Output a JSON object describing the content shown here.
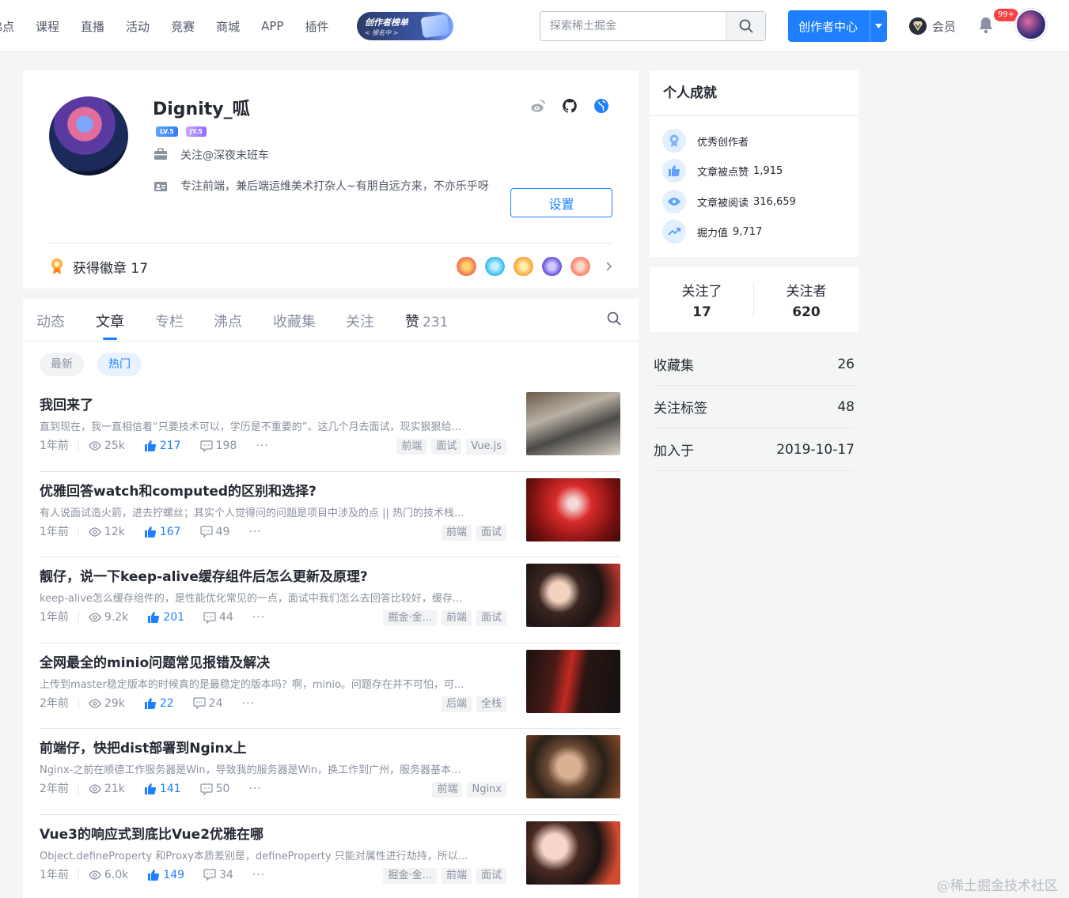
{
  "header": {
    "nav": [
      "沸点",
      "课程",
      "直播",
      "活动",
      "竞赛",
      "商城",
      "APP",
      "插件"
    ],
    "banner": {
      "title": "创作者榜单",
      "subtitle": "< 报名中 >"
    },
    "search_placeholder": "探索稀土掘金",
    "creator_center": "创作者中心",
    "vip_label": "会员",
    "notification_badge": "99+"
  },
  "profile": {
    "username": "Dignity_呱",
    "level": "LV.5",
    "jy_level": "JY.5",
    "position": "关注@深夜末班车",
    "bio": "专注前端，兼后端运维美术打杂人~有朋自远方来，不亦乐乎呀",
    "settings_label": "设置",
    "badges_label": "获得徽章 17",
    "socials": [
      "weibo-icon",
      "github-icon",
      "website-icon"
    ]
  },
  "tabs": {
    "items": [
      "动态",
      "文章",
      "专栏",
      "沸点",
      "收藏集",
      "关注",
      "赞"
    ],
    "likes_count": "231",
    "active": "文章"
  },
  "filters": [
    "最新",
    "热门"
  ],
  "articles": [
    {
      "title": "我回来了",
      "brief": "直到现在，我一直相信着“只要技术可以，学历是不重要的”。这几个月去面试，现实狠狠给...",
      "time": "1年前",
      "views": "25k",
      "likes": "217",
      "comments": "198",
      "tags": [
        "前端",
        "面试",
        "Vue.js"
      ]
    },
    {
      "title": "优雅回答watch和computed的区别和选择?",
      "brief": "有人说面试造火箭，进去拧螺丝；其实个人觉得问的问题是项目中涉及的点 || 热门的技术栈...",
      "time": "1年前",
      "views": "12k",
      "likes": "167",
      "comments": "49",
      "tags": [
        "前端",
        "面试"
      ]
    },
    {
      "title": "靓仔，说一下keep-alive缓存组件后怎么更新及原理?",
      "brief": "keep-alive怎么缓存组件的，是性能优化常见的一点，面试中我们怎么去回答比较好，缓存...",
      "time": "1年前",
      "views": "9.2k",
      "likes": "201",
      "comments": "44",
      "tags": [
        "掘金·金...",
        "前端",
        "面试"
      ]
    },
    {
      "title": "全网最全的minio问题常见报错及解决",
      "brief": "上传到master稳定版本的时候真的是最稳定的版本吗？啊，minio。问题存在并不可怕，可...",
      "time": "2年前",
      "views": "29k",
      "likes": "22",
      "comments": "24",
      "tags": [
        "后端",
        "全栈"
      ]
    },
    {
      "title": "前端仔，快把dist部署到Nginx上",
      "brief": "Nginx-之前在顺德工作服务器是Win，导致我的服务器是Win，换工作到广州，服务器基本...",
      "time": "2年前",
      "views": "21k",
      "likes": "141",
      "comments": "50",
      "tags": [
        "前端",
        "Nginx"
      ]
    },
    {
      "title": "Vue3的响应式到底比Vue2优雅在哪",
      "brief": "Object.defineProperty 和Proxy本质差别是，defineProperty 只能对属性进行劫持，所以...",
      "time": "1年前",
      "views": "6.0k",
      "likes": "149",
      "comments": "34",
      "tags": [
        "掘金·金...",
        "前端",
        "面试"
      ]
    }
  ],
  "achievements": {
    "title": "个人成就",
    "items": [
      {
        "label": "优秀创作者",
        "value": ""
      },
      {
        "label": "文章被点赞",
        "value": "1,915"
      },
      {
        "label": "文章被阅读",
        "value": "316,659"
      },
      {
        "label": "掘力值",
        "value": "9,717"
      }
    ]
  },
  "follow": {
    "following_label": "关注了",
    "following": "17",
    "followers_label": "关注者",
    "followers": "620"
  },
  "stats": [
    {
      "label": "收藏集",
      "value": "26"
    },
    {
      "label": "关注标签",
      "value": "48"
    },
    {
      "label": "加入于",
      "value": "2019-10-17"
    }
  ],
  "watermark": "@稀土掘金技术社区",
  "colors": {
    "accent": "#1e80ff",
    "text": "#252933",
    "muted": "#8a919f"
  }
}
